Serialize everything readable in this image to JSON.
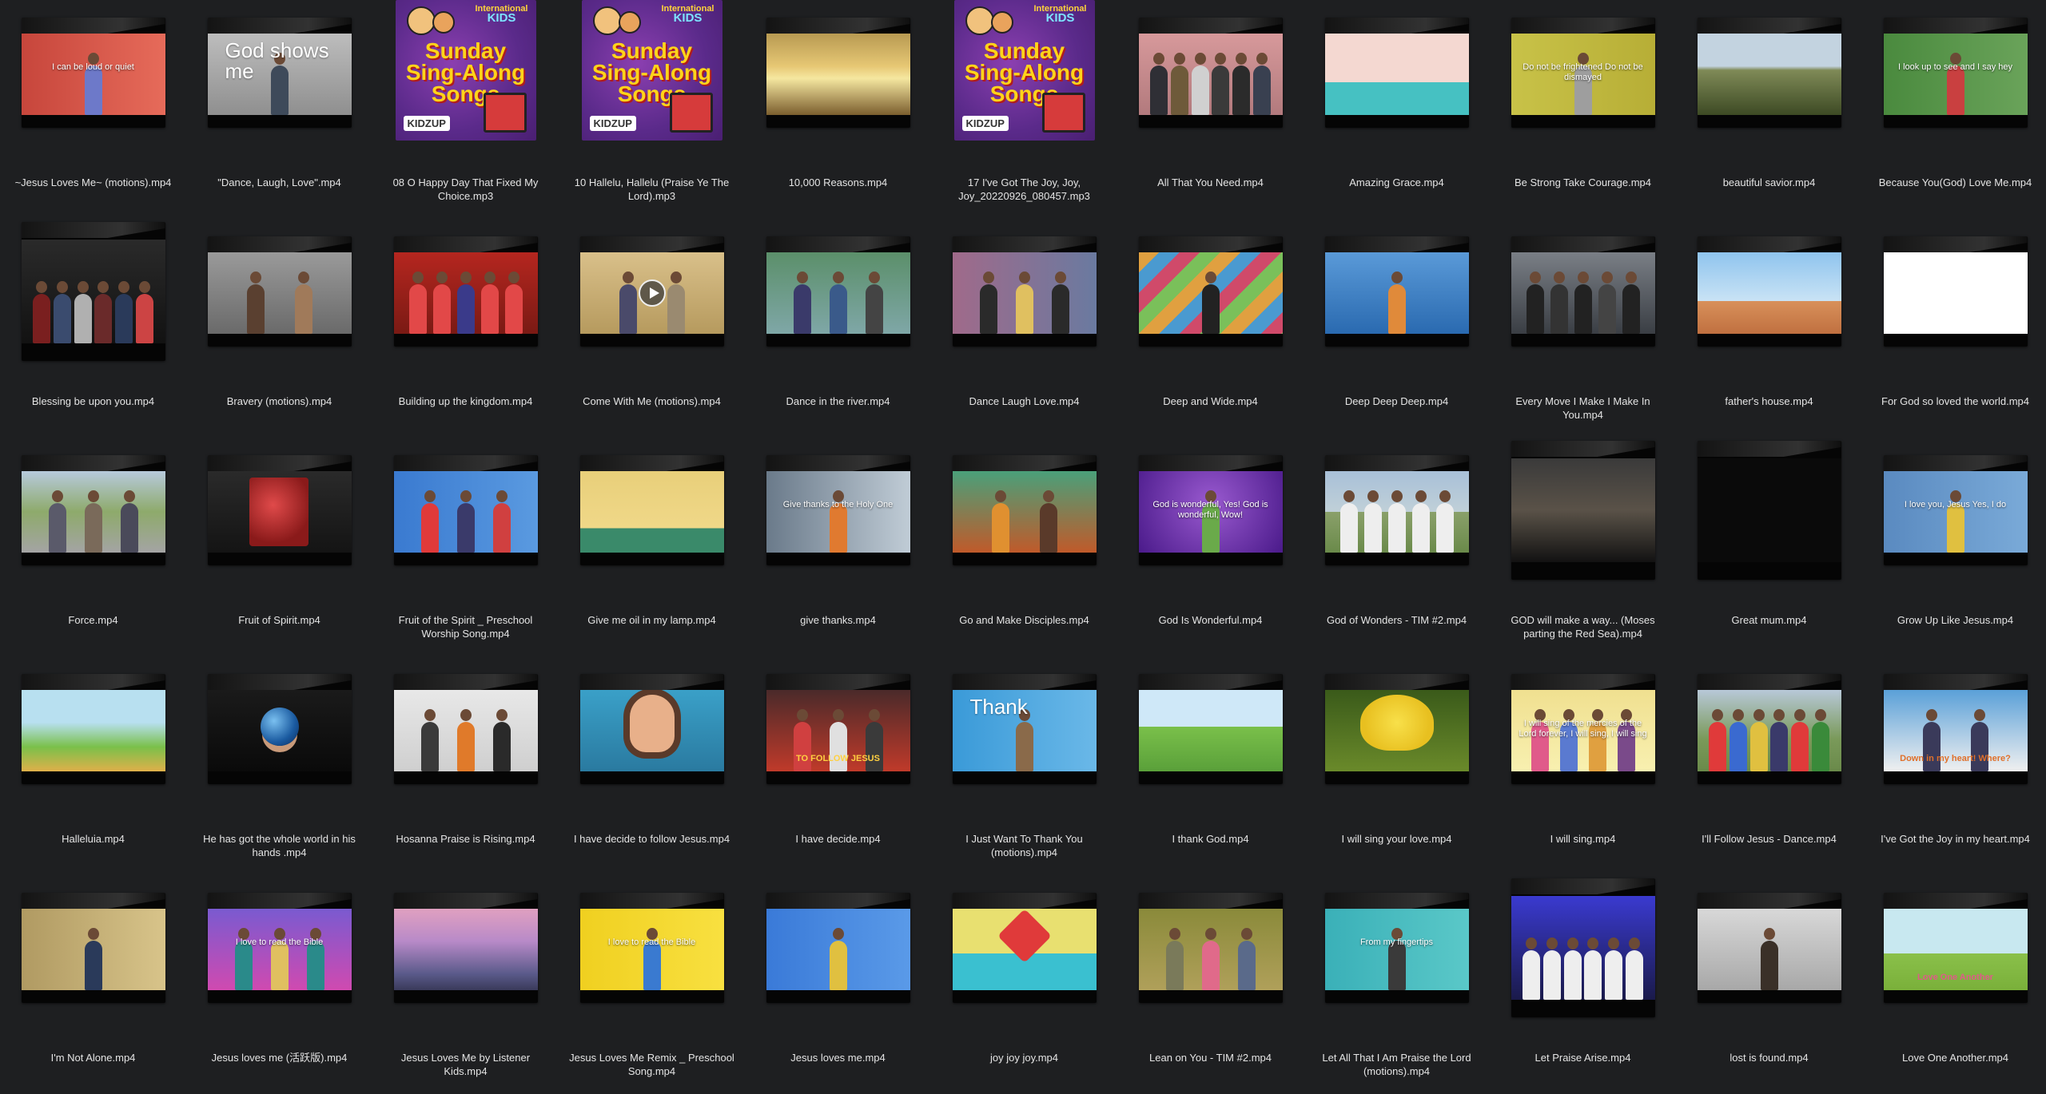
{
  "files": [
    {
      "name": "~Jesus Loves Me~ (motions).mp4",
      "kind": "video",
      "bg": "linear-gradient(90deg,#c7463c,#e66b5a)",
      "text": "I can be loud or quiet",
      "people": [
        "#6d79c9"
      ]
    },
    {
      "name": "\"Dance, Laugh, Love\".mp4",
      "kind": "video",
      "bg": "linear-gradient(180deg,#bdbdbd,#8f8f8f)",
      "big": "God shows me",
      "people": [
        "#3e4a5a"
      ]
    },
    {
      "name": "08 O Happy Day That Fixed My Choice.mp3",
      "kind": "album"
    },
    {
      "name": "10 Hallelu, Hallelu (Praise Ye The Lord).mp3",
      "kind": "album"
    },
    {
      "name": "10,000 Reasons.mp4",
      "kind": "video",
      "bg": "linear-gradient(180deg,#b89a52 0%,#e6c774 40%,#f5e7a0 55%,#7b5e2e 100%)"
    },
    {
      "name": "17 I've Got The Joy, Joy, Joy_20220926_080457.mp3",
      "kind": "album"
    },
    {
      "name": "All That You Need.mp4",
      "kind": "video",
      "bg": "linear-gradient(180deg,#d7999b,#b27a7d)",
      "people": [
        "#2f2f35",
        "#6e5a3a",
        "#d0d0d0",
        "#3a3a3a",
        "#2b2b2b",
        "#394050"
      ]
    },
    {
      "name": "Amazing Grace.mp4",
      "kind": "video",
      "bg": "linear-gradient(180deg,#f4d8d1 0%,#f4d8d1 60%,#46c1c2 60%,#46c1c2 100%)"
    },
    {
      "name": "Be Strong Take Courage.mp4",
      "kind": "video",
      "bg": "linear-gradient(90deg,#c8c248,#b7ae36)",
      "text": "Do not be frightened Do not be dismayed",
      "people": [
        "#9e9e9e"
      ]
    },
    {
      "name": "beautiful savior.mp4",
      "kind": "video",
      "bg": "linear-gradient(180deg,#c3d3e0 0%,#c3d3e0 40%,#7f8a57 45%,#3d4a24 100%)"
    },
    {
      "name": "Because You(God) Love Me.mp4",
      "kind": "video",
      "bg": "linear-gradient(90deg,#4a8a3e,#6aa35a)",
      "text": "I look up to see and I say hey",
      "people": [
        "#c94040"
      ]
    },
    {
      "name": "Blessing be upon you.mp4",
      "kind": "video",
      "tall": true,
      "bg": "linear-gradient(180deg,#2a2a2a,#121212)",
      "people": [
        "#7a1f1f",
        "#3a4b6e",
        "#b0b0b0",
        "#6a2a2a",
        "#2a3a5a",
        "#cc4444"
      ]
    },
    {
      "name": "Bravery (motions).mp4",
      "kind": "video",
      "bg": "linear-gradient(180deg,#9a9a9a,#6a6a6a)",
      "people": [
        "#5a4030",
        "#a07a5a"
      ]
    },
    {
      "name": "Building up the kingdom.mp4",
      "kind": "video",
      "bg": "linear-gradient(180deg,#b5261f,#7a1a14)",
      "people": [
        "#e24848",
        "#e24848",
        "#3a3a8a",
        "#e24848",
        "#e24848"
      ]
    },
    {
      "name": "Come With Me (motions).mp4",
      "kind": "video",
      "bg": "linear-gradient(180deg,#d9c08a,#b69a5e)",
      "play": true,
      "people": [
        "#4a4a6a",
        "#9a8a70"
      ]
    },
    {
      "name": "Dance in the river.mp4",
      "kind": "video",
      "bg": "linear-gradient(180deg,#5b8f6a,#7fa7a7)",
      "people": [
        "#3a3a6a",
        "#3a5a8a",
        "#444"
      ]
    },
    {
      "name": "Dance Laugh Love.mp4",
      "kind": "video",
      "bg": "linear-gradient(90deg,#a06a8a,#6a7aa0)",
      "people": [
        "#2a2a2a",
        "#e0c060",
        "#2a2a2a"
      ]
    },
    {
      "name": "Deep and Wide.mp4",
      "kind": "video",
      "bg": "repeating-linear-gradient(135deg,#e0a040 0 18px,#4a9ad0 18px 36px,#d04a6a 36px 54px,#7ac05a 54px 72px)",
      "people": [
        "#222"
      ]
    },
    {
      "name": "Deep Deep Deep.mp4",
      "kind": "video",
      "bg": "linear-gradient(180deg,#5a9ad8,#2a6ab0)",
      "people": [
        "#e08a3a"
      ]
    },
    {
      "name": "Every Move I Make I Make In You.mp4",
      "kind": "video",
      "bg": "linear-gradient(180deg,#7a7f86,#3a3e44)",
      "people": [
        "#222",
        "#333",
        "#222",
        "#444",
        "#222"
      ]
    },
    {
      "name": "father's house.mp4",
      "kind": "video",
      "bg": "linear-gradient(180deg,#8fc4ee 0%,#c9e3f5 60%,#d8905a 60%,#c07040 100%)"
    },
    {
      "name": "For God so loved the world.mp4",
      "kind": "video",
      "bg": "#ffffff"
    },
    {
      "name": "Force.mp4",
      "kind": "video",
      "bg": "linear-gradient(180deg,#b7cadc 0%,#8eaa6b 50%,#a4a4a4 100%)",
      "people": [
        "#5a5a6a",
        "#7a6a5a",
        "#4a4a5a"
      ]
    },
    {
      "name": "Fruit of Spirit.mp4",
      "kind": "video",
      "bg": "linear-gradient(180deg,#2a2a2a,#141414)",
      "fruit": true
    },
    {
      "name": "Fruit of the Spirit _ Preschool Worship Song.mp4",
      "kind": "video",
      "bg": "linear-gradient(90deg,#3a7ad0,#5a9ae0)",
      "people": [
        "#e03a3a",
        "#3a3a6a",
        "#d04040"
      ]
    },
    {
      "name": "Give me oil in my lamp.mp4",
      "kind": "video",
      "bg": "linear-gradient(180deg,#e8cf7a 0%,#f0d888 70%,#3a8a6a 70%,#3a8a6a 100%)"
    },
    {
      "name": "give thanks.mp4",
      "kind": "video",
      "bg": "linear-gradient(90deg,#6a7a8a,#c0ccd6)",
      "text": "Give thanks to the Holy One",
      "people": [
        "#e07a30"
      ]
    },
    {
      "name": "Go and Make Disciples.mp4",
      "kind": "video",
      "bg": "linear-gradient(180deg,#4aa07a,#c05a2a)",
      "people": [
        "#e09030",
        "#5a3a2a"
      ]
    },
    {
      "name": "God Is Wonderful.mp4",
      "kind": "video",
      "bg": "radial-gradient(circle at 50% 40%,#9a5ad0,#4a1a8a)",
      "text": "God is wonderful, Yes! God is wonderful, Wow!",
      "people": [
        "#6aaa4a"
      ]
    },
    {
      "name": "God of Wonders - TIM #2.mp4",
      "kind": "video",
      "bg": "linear-gradient(180deg,#a8c0d8 0%,#c0d0d8 50%,#8aa06a 50%,#6a8a4a 100%)",
      "people": [
        "#eee",
        "#eee",
        "#eee",
        "#eee",
        "#eee"
      ]
    },
    {
      "name": "GOD will make a way... (Moses parting the Red Sea).mp4",
      "kind": "video",
      "tall": true,
      "bg": "linear-gradient(180deg,#3a3a3a 0%,#5a5248 50%,#121212 100%)"
    },
    {
      "name": "Great mum.mp4",
      "kind": "video",
      "tall": true,
      "bg": "#0a0a0a"
    },
    {
      "name": "Grow Up Like Jesus.mp4",
      "kind": "video",
      "bg": "linear-gradient(90deg,#5a8ac0,#7aaad8)",
      "text": "I love you, Jesus Yes, I do",
      "people": [
        "#e0c040"
      ]
    },
    {
      "name": "Halleluia.mp4",
      "kind": "video",
      "bg": "linear-gradient(180deg,#b8e0f0 0%,#b8e0f0 40%,#7ac04a 70%,#e0b04a 100%)"
    },
    {
      "name": "He has got the whole world in his hands .mp4",
      "kind": "video",
      "bg": "linear-gradient(180deg,#1a1a1a,#0a0a0a)",
      "globe": true
    },
    {
      "name": "Hosanna Praise is Rising.mp4",
      "kind": "video",
      "bg": "linear-gradient(180deg,#e8e8e8,#cfcfcf)",
      "people": [
        "#3a3a3a",
        "#e07a2a",
        "#2a2a2a"
      ]
    },
    {
      "name": "I have decide to follow Jesus.mp4",
      "kind": "video",
      "bg": "linear-gradient(180deg,#3aa0c8,#2a7aa0)",
      "face": true
    },
    {
      "name": "I have decide.mp4",
      "kind": "video",
      "bg": "linear-gradient(180deg,#4a2a2a,#c03a2a)",
      "subtext": "TO FOLLOW JESUS",
      "subcolor": "#ffd040",
      "people": [
        "#d04040",
        "#e0e0e0",
        "#3a3a3a"
      ]
    },
    {
      "name": "I Just Want To Thank You (motions).mp4",
      "kind": "video",
      "bg": "linear-gradient(90deg,#3a9ad8,#6ab8e8)",
      "big": "Thank",
      "people": [
        "#8a6a4a"
      ]
    },
    {
      "name": "I thank God.mp4",
      "kind": "video",
      "bg": "linear-gradient(180deg,#cfe8f8 0%,#cfe8f8 45%,#7ac04a 45%,#5aa03a 100%)"
    },
    {
      "name": "I will sing your love.mp4",
      "kind": "video",
      "bg": "linear-gradient(180deg,#3a5a1a,#6a8a2a)",
      "flower": true
    },
    {
      "name": "I will sing.mp4",
      "kind": "video",
      "bg": "linear-gradient(180deg,#f0e090,#f8f0b0)",
      "text": "I will sing of the mercies of the Lord forever, I will sing, I will sing",
      "people": [
        "#e05a8a",
        "#5a7ad0",
        "#e0a040",
        "#7a4a8a"
      ]
    },
    {
      "name": "I'll Follow Jesus - Dance.mp4",
      "kind": "video",
      "bg": "linear-gradient(180deg,#b8c8d8 0%,#7a9a5a 60%,#6a8a4a 100%)",
      "people": [
        "#e03a3a",
        "#3a6ad0",
        "#e0c040",
        "#3a3a6a",
        "#e03a3a",
        "#3a8a3a"
      ]
    },
    {
      "name": "I've Got the Joy in my heart.mp4",
      "kind": "video",
      "bg": "linear-gradient(180deg,#5aa0d8,#f0f0f0)",
      "subtext": "Down in my heart! Where?",
      "subcolor": "#e0702a",
      "people": [
        "#3a3a5a",
        "#3a3a5a"
      ]
    },
    {
      "name": "I'm Not Alone.mp4",
      "kind": "video",
      "bg": "linear-gradient(90deg,#b09a62,#d8c48a)",
      "people": [
        "#2a3a5a"
      ]
    },
    {
      "name": "Jesus loves me (活跃版).mp4",
      "kind": "video",
      "bg": "linear-gradient(180deg,#7a5ad0,#d04ab0)",
      "text": "I love to read the Bible",
      "people": [
        "#2a8a8a",
        "#e0c060",
        "#2a8a8a"
      ]
    },
    {
      "name": "Jesus Loves Me by Listener Kids.mp4",
      "kind": "video",
      "bg": "linear-gradient(180deg,#e0a0c0 0%,#b88ac8 40%,#5a5a8a 80%,#3a3a5a 100%)"
    },
    {
      "name": "Jesus Loves Me Remix _ Preschool Song.mp4",
      "kind": "video",
      "bg": "linear-gradient(90deg,#f0d020,#f8e040)",
      "text": "I love to read the Bible",
      "people": [
        "#3a7ad0"
      ]
    },
    {
      "name": "Jesus loves me.mp4",
      "kind": "video",
      "bg": "linear-gradient(90deg,#3a7ad8,#5a9ae8)",
      "people": [
        "#e0c040"
      ]
    },
    {
      "name": "joy joy joy.mp4",
      "kind": "video",
      "bg": "linear-gradient(180deg,#e8e070 0%,#e8e070 55%,#3ac0d0 55%,#3ac0d0 100%)",
      "heart": true
    },
    {
      "name": "Lean on You - TIM #2.mp4",
      "kind": "video",
      "bg": "linear-gradient(180deg,#8a8a3a,#b0a05a)",
      "people": [
        "#7a7a5a",
        "#e06a8a",
        "#5a6a8a"
      ]
    },
    {
      "name": "Let All That I Am Praise the Lord (motions).mp4",
      "kind": "video",
      "bg": "linear-gradient(90deg,#3ab0b8,#5ac8c8)",
      "text": "From my fingertips",
      "people": [
        "#3a3a3a"
      ]
    },
    {
      "name": "Let Praise Arise.mp4",
      "kind": "video",
      "tall": true,
      "bg": "linear-gradient(180deg,#3a3ad0,#1a1a4a)",
      "people": [
        "#eee",
        "#eee",
        "#eee",
        "#eee",
        "#eee",
        "#eee"
      ]
    },
    {
      "name": "lost is found.mp4",
      "kind": "video",
      "bg": "linear-gradient(180deg,#d8d8d8,#a8a8a8)",
      "people": [
        "#3a3028"
      ]
    },
    {
      "name": "Love One Another.mp4",
      "kind": "video",
      "bg": "linear-gradient(180deg,#c8e8f0 0%,#c8e8f0 55%,#8ac04a 55%,#7ab03a 100%)",
      "subtext": "Love One Another",
      "subcolor": "#e05a8a"
    }
  ]
}
